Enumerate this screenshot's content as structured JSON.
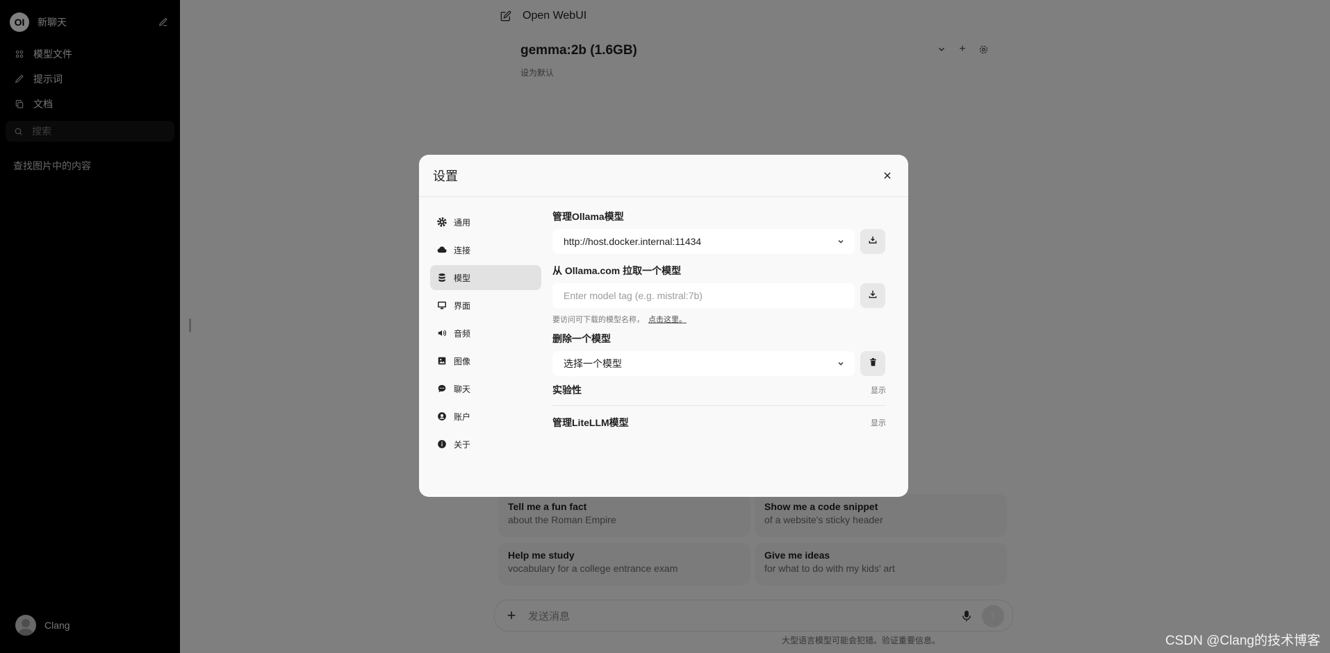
{
  "sidebar": {
    "logo": "OI",
    "new_chat": "新聊天",
    "nav": [
      {
        "label": "模型文件",
        "icon": "modelfiles-icon"
      },
      {
        "label": "提示词",
        "icon": "pencil-icon"
      },
      {
        "label": "文档",
        "icon": "documents-icon"
      }
    ],
    "search_placeholder": "搜索",
    "history": [
      "查找图片中的内容"
    ],
    "user": "Clang"
  },
  "header": {
    "title": "Open WebUI",
    "model": "gemma:2b (1.6GB)",
    "set_default": "设为默认"
  },
  "suggestions": [
    {
      "title": "Tell me a fun fact",
      "subtitle": "about the Roman Empire"
    },
    {
      "title": "Show me a code snippet",
      "subtitle": "of a website's sticky header"
    },
    {
      "title": "Help me study",
      "subtitle": "vocabulary for a college entrance exam"
    },
    {
      "title": "Give me ideas",
      "subtitle": "for what to do with my kids' art"
    }
  ],
  "input": {
    "placeholder": "发送消息",
    "disclaimer": "大型语言模型可能会犯错。验证重要信息。"
  },
  "watermark": "CSDN @Clang的技术博客",
  "modal": {
    "title": "设置",
    "tabs": [
      {
        "label": "通用",
        "icon": "gear-icon"
      },
      {
        "label": "连接",
        "icon": "cloud-icon"
      },
      {
        "label": "模型",
        "icon": "database-icon"
      },
      {
        "label": "界面",
        "icon": "monitor-icon"
      },
      {
        "label": "音频",
        "icon": "speaker-icon"
      },
      {
        "label": "图像",
        "icon": "image-icon"
      },
      {
        "label": "聊天",
        "icon": "chat-bubble-icon"
      },
      {
        "label": "账户",
        "icon": "user-circle-icon"
      },
      {
        "label": "关于",
        "icon": "info-icon"
      }
    ],
    "active_tab": "模型",
    "manage_ollama": {
      "title": "管理Ollama模型",
      "url_value": "http://host.docker.internal:11434"
    },
    "pull": {
      "title": "从 Ollama.com 拉取一个模型",
      "placeholder": "Enter model tag (e.g. mistral:7b)",
      "hint": "要访问可下载的模型名称，",
      "hint_link": "点击这里。"
    },
    "delete": {
      "title": "删除一个模型",
      "select_value": "选择一个模型"
    },
    "experimental": {
      "title": "实验性",
      "toggle": "显示"
    },
    "litellm": {
      "title": "管理LiteLLM模型",
      "toggle": "显示"
    }
  }
}
